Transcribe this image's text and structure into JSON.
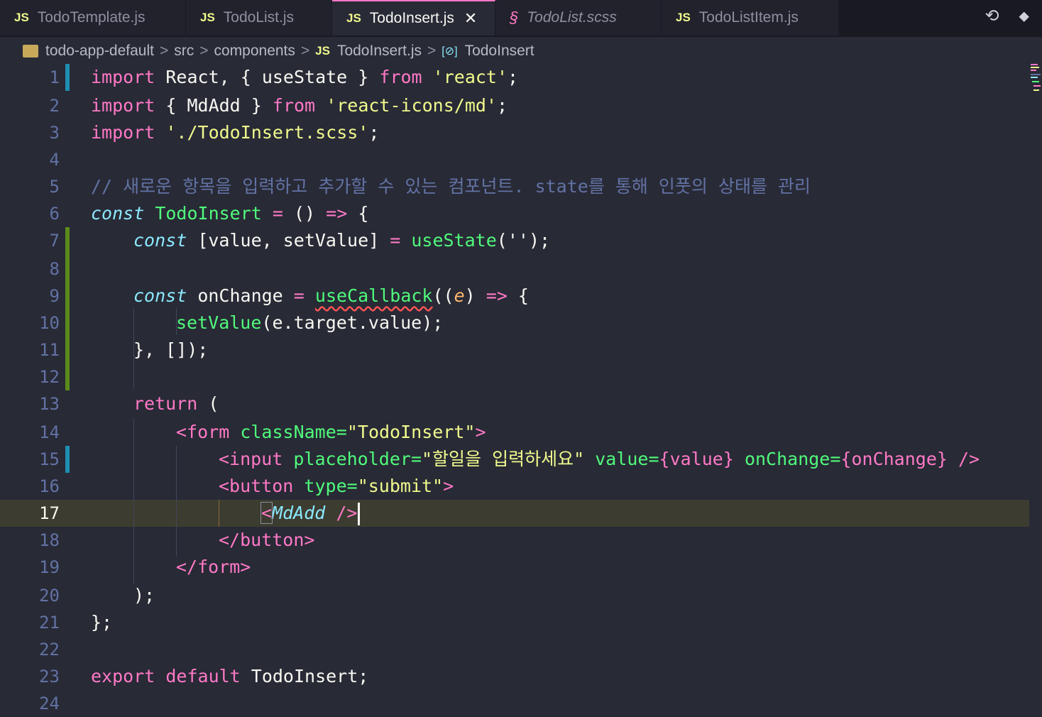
{
  "tabs": [
    {
      "type": "JS",
      "label": "TodoTemplate.js",
      "width": 262
    },
    {
      "type": "JS",
      "label": "TodoList.js",
      "width": 206
    },
    {
      "type": "JS",
      "label": "TodoInsert.js",
      "active": true,
      "width": 230
    },
    {
      "type": "SCSS",
      "label": "TodoList.scss",
      "width": 234
    },
    {
      "type": "JS",
      "label": "TodoListItem.js",
      "width": 250
    }
  ],
  "tab_actions": {
    "compare_icon": "⟲",
    "git_icon": "◆"
  },
  "breadcrumb": {
    "folder": "todo-app-default",
    "src": "src",
    "components": "components",
    "file_icon": "JS",
    "file": "TodoInsert.js",
    "symbol_icon": "[⊘]",
    "symbol": "TodoInsert",
    "sep": ">"
  },
  "editor": {
    "current_line": 17,
    "lines": [
      {
        "n": "1"
      },
      {
        "n": "2"
      },
      {
        "n": "3"
      },
      {
        "n": "4"
      },
      {
        "n": "5"
      },
      {
        "n": "6"
      },
      {
        "n": "7"
      },
      {
        "n": "8"
      },
      {
        "n": "9"
      },
      {
        "n": "10"
      },
      {
        "n": "11"
      },
      {
        "n": "12"
      },
      {
        "n": "13"
      },
      {
        "n": "14"
      },
      {
        "n": "15"
      },
      {
        "n": "16"
      },
      {
        "n": "17"
      },
      {
        "n": "18"
      },
      {
        "n": "19"
      },
      {
        "n": "20"
      },
      {
        "n": "21"
      },
      {
        "n": "22"
      },
      {
        "n": "23"
      },
      {
        "n": "24"
      }
    ],
    "code": {
      "l1": {
        "import": "import",
        "a": " React, { useState } ",
        "from": "from",
        "sp": " ",
        "str": "'react'",
        "end": ";"
      },
      "l2": {
        "import": "import",
        "a": " { MdAdd } ",
        "from": "from",
        "sp": " ",
        "str": "'react-icons/md'",
        "end": ";"
      },
      "l3": {
        "import": "import",
        "sp": " ",
        "str": "'./TodoInsert.scss'",
        "end": ";"
      },
      "l5": {
        "comment": "// 새로운 항목을 입력하고 추가할 수 있는 컴포넌트. state를 통해 인풋의 상태를 관리"
      },
      "l6": {
        "const": "const",
        "sp": " ",
        "name": "TodoInsert",
        "eq": " = ",
        "paren": "() ",
        "arrow": "=>",
        "brace": " {"
      },
      "l7": {
        "const": "const",
        "a": " [value, setValue] ",
        "eq": "=",
        "sp": " ",
        "fn": "useState",
        "end": "('');"
      },
      "l9": {
        "const": "const",
        "a": " onChange ",
        "eq": "=",
        "sp": " ",
        "fn": "useCallback",
        "open": "((",
        "param": "e",
        "close": ") ",
        "arrow": "=>",
        "brace": " {"
      },
      "l10": {
        "fn": "setValue",
        "rest": "(e.target.value);"
      },
      "l11": {
        "text": "}, []);"
      },
      "l13": {
        "ret": "return",
        "rest": " ("
      },
      "l14": {
        "open": "<form",
        "sp": " ",
        "attr": "className=",
        "val": "\"TodoInsert\"",
        "close": ">"
      },
      "l15": {
        "open": "<input",
        "sp": " ",
        "a1": "placeholder=",
        "v1": "\"할일을 입력하세요\"",
        "sp2": " ",
        "a2": "value=",
        "v2": "{value}",
        "sp3": " ",
        "a3": "onChange=",
        "v3": "{onChange}",
        "close": " />"
      },
      "l16": {
        "open": "<button",
        "sp": " ",
        "attr": "type=",
        "val": "\"submit\"",
        "close": ">"
      },
      "l17": {
        "lt": "<",
        "comp": "MdAdd",
        "close": " />"
      },
      "l18": {
        "text": "</button>"
      },
      "l19": {
        "text": "</form>"
      },
      "l20": {
        "text": ");"
      },
      "l21": {
        "text": "};"
      },
      "l23": {
        "exp": "export default",
        "rest": " TodoInsert;"
      }
    }
  },
  "colors": {
    "background": "#282a36",
    "keyword": "#ff79c6",
    "string": "#f1fa8c",
    "function": "#50fa7b",
    "comment": "#6272a4",
    "storage": "#8be9fd",
    "param": "#ffb86c"
  }
}
